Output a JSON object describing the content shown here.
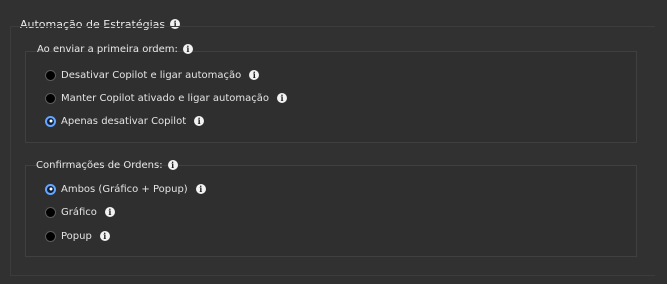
{
  "section": {
    "title": "Automação de Estratégias",
    "info_icon": "info-icon"
  },
  "first_order": {
    "title": "Ao enviar a primeira ordem:",
    "options": [
      {
        "label": "Desativar Copilot e ligar automação",
        "checked": false
      },
      {
        "label": "Manter Copilot ativado e ligar automação",
        "checked": false
      },
      {
        "label": "Apenas desativar Copilot",
        "checked": true
      }
    ]
  },
  "order_confirmations": {
    "title": "Confirmações de Ordens:",
    "options": [
      {
        "label": "Ambos (Gráfico + Popup)",
        "checked": true
      },
      {
        "label": "Gráfico",
        "checked": false
      },
      {
        "label": "Popup",
        "checked": false
      }
    ]
  },
  "colors": {
    "background": "#313131",
    "radio_selected": "#66a6ff"
  }
}
